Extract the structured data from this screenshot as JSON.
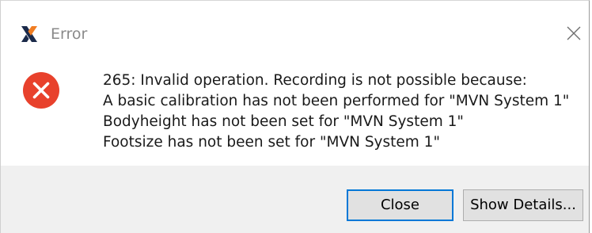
{
  "dialog": {
    "title": "Error",
    "message_lines": [
      "265: Invalid operation. Recording is not possible because:",
      "A basic calibration has not been performed for \"MVN System 1\"",
      "Bodyheight has not been set for \"MVN System 1\"",
      "Footsize has not been set for \"MVN System 1\""
    ],
    "buttons": {
      "close_label": "Close",
      "details_label": "Show Details..."
    }
  },
  "icons": {
    "app": "xsens-logo-icon",
    "error": "error-circle-icon",
    "window_close": "close-icon"
  },
  "colors": {
    "error_red": "#e8412c",
    "logo_dark": "#1b2a4a",
    "logo_orange": "#f07d22",
    "focus_border": "#0078d7",
    "footer_bg": "#f0f0f0"
  }
}
